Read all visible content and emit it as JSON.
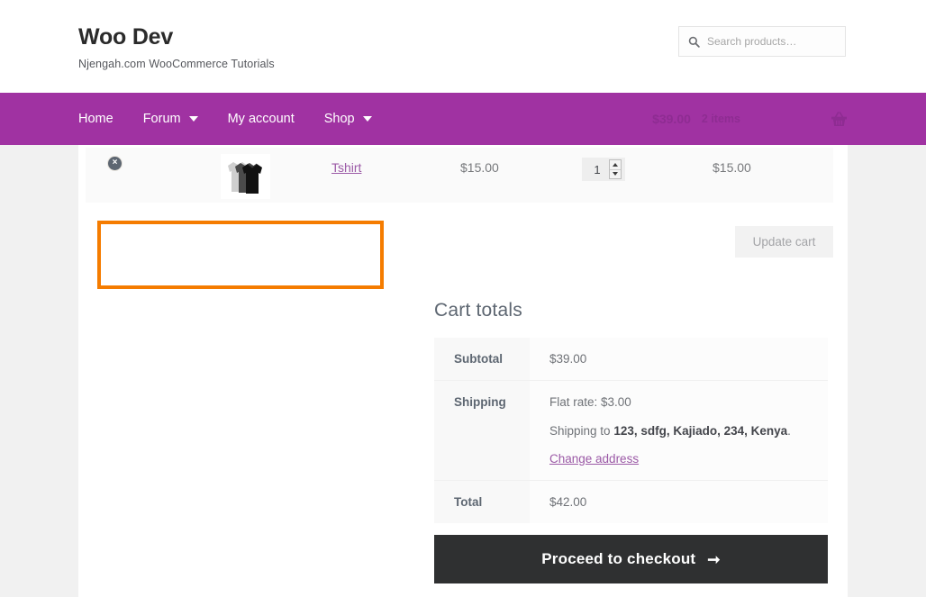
{
  "colors": {
    "nav_purple": "#a032a2",
    "page_bg": "#f1f1f1",
    "content_bg": "#ffffff",
    "annotation_orange": "#f57c00",
    "link_purple": "#9b59a6",
    "checkout_dark": "#2f3031"
  },
  "header": {
    "site_title": "Woo Dev",
    "tagline": "Njengah.com WooCommerce Tutorials",
    "search": {
      "placeholder": "Search products…",
      "value": "",
      "icon": "search-icon"
    }
  },
  "nav": {
    "items": [
      {
        "label": "Home",
        "has_caret": false
      },
      {
        "label": "Forum",
        "has_caret": true
      },
      {
        "label": "My account",
        "has_caret": false
      },
      {
        "label": "Shop",
        "has_caret": true
      }
    ],
    "cart": {
      "amount": "$39.00",
      "count": "2 items",
      "icon": "shopping-basket-icon"
    }
  },
  "cart_table": {
    "row": {
      "remove_label": "×",
      "thumbnail_alt": "tshirt-thumbnail",
      "product_name": "Tshirt",
      "price": "$15.00",
      "quantity": "1",
      "subtotal": "$15.00"
    },
    "update_cart_label": "Update cart"
  },
  "annotation": {
    "note": "empty-highlight-box"
  },
  "cart_totals": {
    "heading": "Cart totals",
    "rows": [
      {
        "label": "Subtotal",
        "value": "$39.00"
      },
      {
        "label": "Shipping",
        "value": ""
      },
      {
        "label": "Total",
        "value": "$42.00"
      }
    ],
    "shipping": {
      "rate": "Flat rate: $3.00",
      "shipping_to_prefix": "Shipping to ",
      "address": "123, sdfg, Kajiado, 234, Kenya",
      "shipping_to_suffix": ".",
      "change_address_label": "Change address"
    }
  },
  "checkout": {
    "label": "Proceed to checkout",
    "arrow": "➞"
  }
}
